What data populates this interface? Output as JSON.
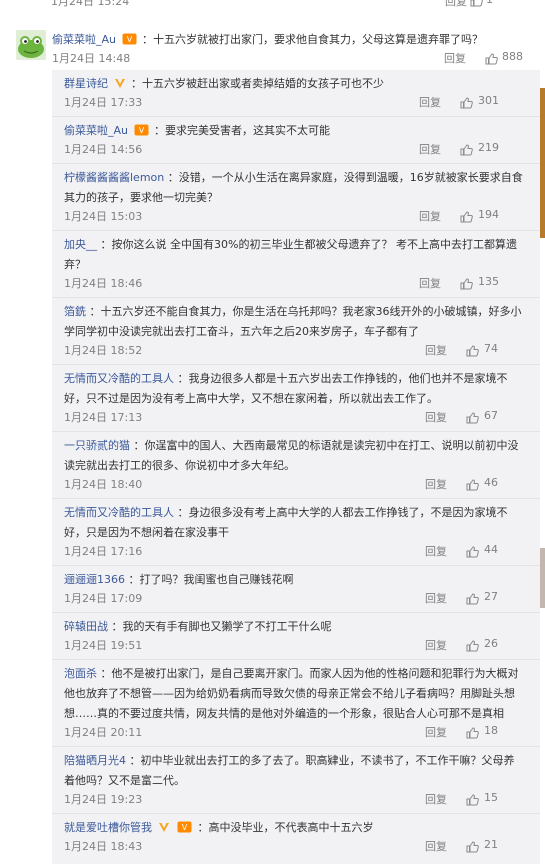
{
  "prev": {
    "time": "1月24日 15:24",
    "reply": "回复",
    "likes": "1"
  },
  "main": {
    "user": "偷菜菜啦_Au",
    "content": "：十五六岁就被打出家门，要求他自食其力，父母这算是遗弃罪了吗？",
    "time": "1月24日 14:48",
    "reply": "回复",
    "likes": "888"
  },
  "replies": [
    {
      "user": "群星诗纪",
      "content": "：十五六岁被赶出家或者卖掉结婚的女孩子可也不少",
      "lines": [],
      "time": "1月24日 17:33",
      "reply": "回复",
      "likes": "301"
    },
    {
      "user": "偷菜菜啦_Au",
      "content": "：要求完美受害者，这其实不太可能",
      "lines": [],
      "time": "1月24日 14:56",
      "reply": "回复",
      "likes": "219"
    },
    {
      "user": "柠檬酱酱酱酱lemon",
      "content": "：没错，一个从小生活在离异家庭，没得到温暖，16岁就被家长要求自食",
      "lines": [
        "其力的孩子，要求他一切完美？"
      ],
      "time": "1月24日 15:03",
      "reply": "回复",
      "likes": "194"
    },
    {
      "user": "加央__",
      "content": "：按你这么说 全中国有30%的初三毕业生都被父母遗弃了？  考不上高中去打工都算遗",
      "lines": [
        "弃？"
      ],
      "time": "1月24日 18:46",
      "reply": "回复",
      "likes": "135"
    },
    {
      "user": "箔銑",
      "content": "：十五六岁还不能自食其力，你是生活在乌托邦吗？我老家36线开外的小破城镇，好多小",
      "lines": [
        "学同学初中没读完就出去打工奋斗，五六年之后20来岁房子，车子都有了"
      ],
      "time": "1月24日 18:52",
      "reply": "回复",
      "likes": "74"
    },
    {
      "user": "无情而又冷酷的工具人",
      "content": "：我身边很多人都是十五六岁出去工作挣钱的，他们也并不是家境不",
      "lines": [
        "好，只不过是因为没有考上高中大学，又不想在家闲着，所以就出去工作了。"
      ],
      "time": "1月24日 17:13",
      "reply": "回复",
      "likes": "67"
    },
    {
      "user": "一只骄贰的猫",
      "content": "：你逞富中的国人、大西南最常见的标语就是读完初中在打工、说明以前初中没",
      "lines": [
        "读完就出去打工的很多、你说初中才多大年纪。"
      ],
      "time": "1月24日 18:40",
      "reply": "回复",
      "likes": "46"
    },
    {
      "user": "无情而又冷酷的工具人",
      "content": "：身边很多没有考上高中大学的人都去工作挣钱了，不是因为家境不",
      "lines": [
        "好，只是因为不想闲着在家没事干"
      ],
      "time": "1月24日 17:16",
      "reply": "回复",
      "likes": "44"
    },
    {
      "user": "逦逦逦1366",
      "content": "：打了吗？我闺蜜也自己赚钱花啊",
      "lines": [],
      "time": "1月24日 17:09",
      "reply": "回复",
      "likes": "27"
    },
    {
      "user": "碎辕田战",
      "content": "：我的天有手有脚也又獭学了不打工干什么呢",
      "lines": [],
      "time": "1月24日 19:51",
      "reply": "回复",
      "likes": "26"
    },
    {
      "user": "泡面杀",
      "content": "：他不是被打出家门，是自己要离开家门。而家人因为他的性格问题和犯罪行为大概对",
      "lines": [
        "他也放弃了不想管——因为给奶奶看病而导致欠债的母亲正常会不给儿子看病吗？用脚趾头想",
        "想……真的不要过度共情，网友共情的是他对外编造的一个形象，很贴合人心可那不是真相"
      ],
      "time": "1月24日 20:11",
      "reply": "回复",
      "likes": "18"
    },
    {
      "user": "陪猫晒月光4",
      "content": "：初中毕业就出去打工的多了去了。职高肄业，不读书了，不工作干嘛？父母养",
      "lines": [
        "着他吗？又不是富二代。"
      ],
      "time": "1月24日 19:23",
      "reply": "回复",
      "likes": "15"
    },
    {
      "user": "就是爱吐槽你管我",
      "content": "：高中没毕业，不代表高中十五六岁",
      "lines": [],
      "time": "1月24日 18:43",
      "reply": "回复",
      "likes": "21"
    }
  ]
}
